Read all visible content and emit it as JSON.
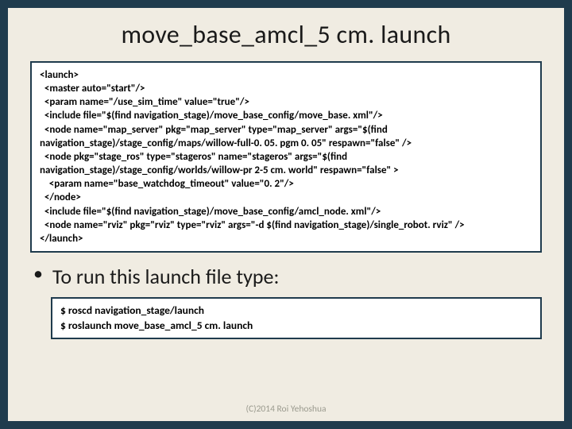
{
  "title": "move_base_amcl_5 cm. launch",
  "launch_code": "<launch>\n  <master auto=\"start\"/>\n  <param name=\"/use_sim_time\" value=\"true\"/>\n  <include file=\"$(find navigation_stage)/move_base_config/move_base. xml\"/>\n  <node name=\"map_server\" pkg=\"map_server\" type=\"map_server\" args=\"$(find navigation_stage)/stage_config/maps/willow-full-0. 05. pgm 0. 05\" respawn=\"false\" />\n  <node pkg=\"stage_ros\" type=\"stageros\" name=\"stageros\" args=\"$(find navigation_stage)/stage_config/worlds/willow-pr 2-5 cm. world\" respawn=\"false\" >\n    <param name=\"base_watchdog_timeout\" value=\"0. 2\"/>\n  </node>\n  <include file=\"$(find navigation_stage)/move_base_config/amcl_node. xml\"/>\n  <node name=\"rviz\" pkg=\"rviz\" type=\"rviz\" args=\"-d $(find navigation_stage)/single_robot. rviz\" />\n</launch>",
  "bullet_text": "To run this launch file type:",
  "run_commands": "$ roscd navigation_stage/launch\n$ roslaunch move_base_amcl_5 cm. launch",
  "footer": "(C)2014 Roi Yehoshua"
}
